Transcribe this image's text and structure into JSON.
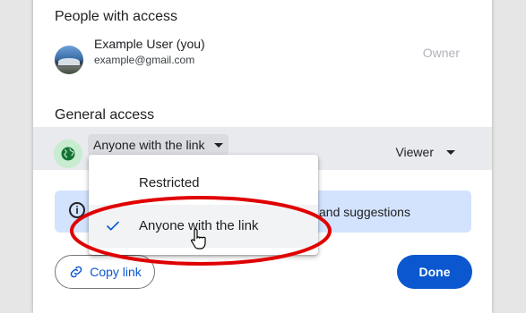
{
  "dialog": {
    "people_title": "People with access",
    "user": {
      "name": "Example User (you)",
      "email": "example@gmail.com",
      "role": "Owner"
    },
    "general_title": "General access",
    "access": {
      "selected": "Anyone with the link",
      "role": "Viewer"
    },
    "banner_text": "and suggestions",
    "copy_link_label": "Copy link",
    "done_label": "Done"
  },
  "menu": {
    "items": [
      {
        "label": "Restricted",
        "selected": false
      },
      {
        "label": "Anyone with the link",
        "selected": true
      }
    ]
  },
  "colors": {
    "accent": "#0b57d0",
    "highlight_ring": "#e00000",
    "globe_bg": "#c7ecd0",
    "banner_bg": "#d3e3fd"
  },
  "icons": {
    "globe": "globe-icon",
    "info": "info-icon",
    "link": "link-icon",
    "check": "check-icon",
    "caret": "caret-down-icon",
    "cursor": "hand-cursor-icon"
  }
}
